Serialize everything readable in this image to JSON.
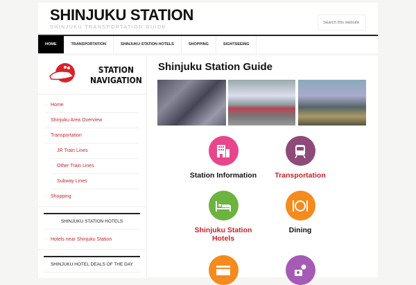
{
  "header": {
    "title": "SHINJUKU STATION",
    "tagline": "SHINJUKU TRANSPORTATION GUIDE",
    "search_placeholder": "Search this website"
  },
  "nav": [
    "HOME",
    "TRANSPORTATION",
    "SHINJUKU STATION HOTELS",
    "SHOPPING",
    "SIGHTSEEING"
  ],
  "sidebar": {
    "logo_line1": "STATION",
    "logo_line2": "NAVIGATION",
    "menu": [
      "Home",
      "Shinjuku Area Overview",
      "Transportation",
      "JR Train Lines",
      "Other Train Lines",
      "Subway Lines",
      "Shopping"
    ],
    "hotels_title": "SHINJUKU STATION HOTELS",
    "hotels_link": "Hotels near Shinjuku Station",
    "deals_title": "SHINJUKU HOTEL DEALS OF THE DAY"
  },
  "main": {
    "title": "Shinjuku Station Guide",
    "tiles": [
      {
        "label": "Station Information",
        "icon": "building-icon",
        "color": "#e8468c",
        "label_color": "#111"
      },
      {
        "label": "Transportation",
        "icon": "train-icon",
        "color": "#8e4a78",
        "label_color": "#c8202a"
      },
      {
        "label": "Shinjuku Station Hotels",
        "icon": "bed-icon",
        "color": "#6cb33f",
        "label_color": "#c8202a"
      },
      {
        "label": "Dining",
        "icon": "dining-icon",
        "color": "#f58a1f",
        "label_color": "#111"
      },
      {
        "label": "",
        "icon": "card-icon",
        "color": "#f58a1f"
      },
      {
        "label": "",
        "icon": "map-pin-camera-icon",
        "color": "#a55bb5"
      }
    ]
  },
  "colors": {
    "accent": "#c0292f"
  }
}
